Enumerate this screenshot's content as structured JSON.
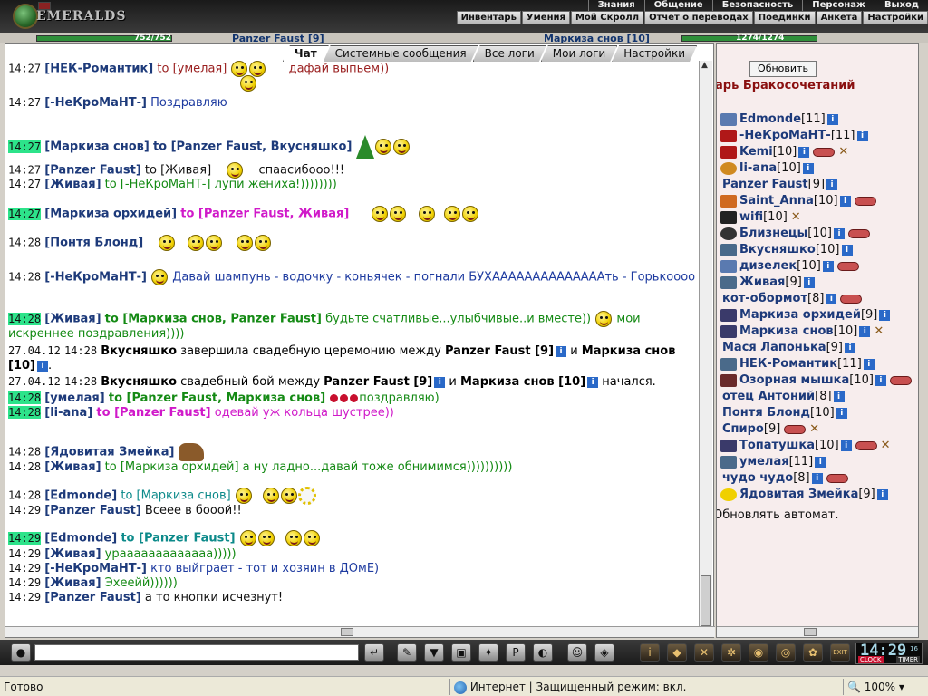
{
  "header": {
    "logo_text": "EMERALDS",
    "top_menu": [
      "Знания",
      "Общение",
      "Безопасность",
      "Персонаж",
      "Выход"
    ],
    "sub_menu": [
      "Инвентарь",
      "Умения",
      "Мой Скролл",
      "Отчет о переводах",
      "Поединки",
      "Анкета",
      "Настройки"
    ]
  },
  "char_strip": {
    "left_hp": "752/752",
    "left_name": "Panzer Faust [9]",
    "right_name": "Маркиза снов [10]",
    "right_hp": "1274/1274"
  },
  "tabs": [
    "Чат",
    "Системные сообщения",
    "Все логи",
    "Мои логи",
    "Настройки"
  ],
  "messages": [
    {
      "time": "14:27",
      "hl": false,
      "from": "[НЕК-Романтик]",
      "to": "to [умелая]",
      "toc": "to-red",
      "text": "дафай выпьем))",
      "tc": "c-red"
    },
    {
      "time": "14:27",
      "hl": false,
      "from": "[-НеКроМаНТ-]",
      "to": "",
      "toc": "",
      "text": "Поздравляю",
      "tc": "c-blue"
    },
    {
      "time": "14:27",
      "hl": true,
      "from": "[Маркиза снов]",
      "to": "to [Panzer Faust, Вкусняшко]",
      "toc": "to-navy",
      "text": "",
      "tc": ""
    },
    {
      "time": "14:27",
      "hl": false,
      "from": "[Panzer Faust]",
      "to": "to [Живая]",
      "toc": "c-black",
      "text": "спаaсибооо!!!",
      "tc": "c-black"
    },
    {
      "time": "14:27",
      "hl": false,
      "from": "[Живая]",
      "to": "to [-НеКроМаНТ-]",
      "toc": "c-green",
      "text": "лупи жениха!))))))))",
      "tc": "c-green"
    },
    {
      "time": "14:27",
      "hl": true,
      "from": "[Маркиза орхидей]",
      "to": "to [Panzer Faust, Живая]",
      "toc": "to-magenta",
      "text": "",
      "tc": ""
    },
    {
      "time": "14:28",
      "hl": false,
      "from": "[Понтя Блонд]",
      "to": "",
      "toc": "",
      "text": "",
      "tc": ""
    },
    {
      "time": "14:28",
      "hl": false,
      "from": "[-НеКроМаНТ-]",
      "to": "",
      "toc": "",
      "text": "Давай шампунь - водочку - коньячек - погнали БУХААААААААААААААть - Горькоооо",
      "tc": "c-blue"
    },
    {
      "time": "14:28",
      "hl": true,
      "from": "[Живая]",
      "to": "to [Маркиза снов, Panzer Faust]",
      "toc": "to-green",
      "text": "будьте счатливые...улыбчивые..и вместе))",
      "tc": "c-green",
      "text2": "мои искреннее поздравления))))"
    },
    {
      "time": "14:28",
      "hl": false,
      "date": "27.04.12",
      "system": "wedding_done"
    },
    {
      "time": "14:28",
      "hl": false,
      "date": "27.04.12",
      "system": "wedding_fight"
    },
    {
      "time": "14:28",
      "hl": true,
      "from": "[умелая]",
      "to": "to [Panzer Faust, Маркиза снов]",
      "toc": "to-green",
      "text": "поздравляю)",
      "tc": "c-green"
    },
    {
      "time": "14:28",
      "hl": true,
      "from": "[li-ana]",
      "to": "to [Panzer Faust]",
      "toc": "to-magenta",
      "text": "одевай уж кольца шустрее))",
      "tc": "c-magenta"
    },
    {
      "time": "14:28",
      "hl": false,
      "from": "[Ядовитая Змейка]",
      "to": "",
      "toc": "",
      "text": "",
      "tc": ""
    },
    {
      "time": "14:28",
      "hl": false,
      "from": "[Живая]",
      "to": "to [Маркиза орхидей]",
      "toc": "c-green",
      "text": "а ну ладно...давай тоже обнимимся))))))))))",
      "tc": "c-green"
    },
    {
      "time": "14:28",
      "hl": false,
      "from": "[Edmonde]",
      "to": "to [Маркиза снов]",
      "toc": "c-teal",
      "text": "",
      "tc": ""
    },
    {
      "time": "14:29",
      "hl": false,
      "from": "[Panzer Faust]",
      "to": "",
      "toc": "",
      "text": "Всеее в бооой!!",
      "tc": "c-black"
    },
    {
      "time": "14:29",
      "hl": true,
      "from": "[Edmonde]",
      "to": "to [Panzer Faust]",
      "toc": "to-teal",
      "text": "",
      "tc": ""
    },
    {
      "time": "14:29",
      "hl": false,
      "from": "[Живая]",
      "to": "",
      "toc": "",
      "text": "урааааааааааааа)))))",
      "tc": "c-green"
    },
    {
      "time": "14:29",
      "hl": false,
      "from": "[-НеКроМаНТ-]",
      "to": "",
      "toc": "",
      "text": "кто выйграет - тот и хозяин в ДОмЕ)",
      "tc": "c-blue"
    },
    {
      "time": "14:29",
      "hl": false,
      "from": "[Живая]",
      "to": "",
      "toc": "",
      "text": "Эхеейй))))))",
      "tc": "c-green"
    },
    {
      "time": "14:29",
      "hl": false,
      "from": "[Panzer Faust]",
      "to": "",
      "toc": "",
      "text": "а то кнопки исчезнут!",
      "tc": "c-black"
    }
  ],
  "system": {
    "done_actor": "Вкусняшко",
    "done_text": "завершила свадебную церемонию между",
    "groom": "Panzer Faust [9]",
    "and": "и",
    "bride": "Маркиза снов [10]",
    "fight_actor": "Вкусняшко",
    "fight_text": "свадебный бой между",
    "fight_end": "начался."
  },
  "right_panel": {
    "refresh_label": "Обновить",
    "room_title": "арь Бракосочетаний",
    "auto_refresh": "Обновлять автомат.",
    "users": [
      {
        "name": "Edmonde",
        "lvl": "[11]",
        "info": true,
        "mute": false,
        "cross": false,
        "icon": "shield"
      },
      {
        "name": "-НеКроМаНТ-",
        "lvl": "[11]",
        "info": true,
        "mute": false,
        "cross": false,
        "icon": "clan-red"
      },
      {
        "name": "Kemi",
        "lvl": "[10]",
        "info": true,
        "mute": true,
        "cross": true,
        "icon": "clan-red"
      },
      {
        "name": "li-ana",
        "lvl": "[10]",
        "info": true,
        "mute": false,
        "cross": false,
        "icon": "sun"
      },
      {
        "name": "Panzer Faust",
        "lvl": "[9]",
        "info": true,
        "mute": false,
        "cross": false,
        "icon": ""
      },
      {
        "name": "Saint_Anna",
        "lvl": "[10]",
        "info": true,
        "mute": true,
        "cross": false,
        "icon": "wings"
      },
      {
        "name": "wifi",
        "lvl": "[10]",
        "info": false,
        "mute": false,
        "cross": true,
        "icon": "dark"
      },
      {
        "name": "Близнецы",
        "lvl": "[10]",
        "info": true,
        "mute": true,
        "cross": false,
        "icon": "yin-yang"
      },
      {
        "name": "Вкусняшко",
        "lvl": "[10]",
        "info": true,
        "mute": false,
        "cross": false,
        "icon": "bird"
      },
      {
        "name": "дизелек",
        "lvl": "[10]",
        "info": true,
        "mute": true,
        "cross": false,
        "icon": "shield"
      },
      {
        "name": "Живая",
        "lvl": "[9]",
        "info": true,
        "mute": false,
        "cross": false,
        "icon": "bird"
      },
      {
        "name": "кот-обормот",
        "lvl": "[8]",
        "info": true,
        "mute": true,
        "cross": false,
        "icon": ""
      },
      {
        "name": "Маркиза орхидей",
        "lvl": "[9]",
        "info": true,
        "mute": false,
        "cross": false,
        "icon": "bat"
      },
      {
        "name": "Маркиза снов",
        "lvl": "[10]",
        "info": true,
        "mute": false,
        "cross": true,
        "icon": "bat"
      },
      {
        "name": "Мася Лапонька",
        "lvl": "[9]",
        "info": true,
        "mute": false,
        "cross": false,
        "icon": ""
      },
      {
        "name": "НЕК-Романтик",
        "lvl": "[11]",
        "info": true,
        "mute": false,
        "cross": false,
        "icon": "bird"
      },
      {
        "name": "Озорная мышка",
        "lvl": "[10]",
        "info": true,
        "mute": true,
        "cross": false,
        "icon": "paw"
      },
      {
        "name": "отец Антоний",
        "lvl": "[8]",
        "info": true,
        "mute": false,
        "cross": false,
        "icon": ""
      },
      {
        "name": "Понтя Блонд",
        "lvl": "[10]",
        "info": true,
        "mute": false,
        "cross": false,
        "icon": ""
      },
      {
        "name": "Спиро",
        "lvl": "[9]",
        "info": false,
        "mute": true,
        "cross": true,
        "icon": ""
      },
      {
        "name": "Топатушка",
        "lvl": "[10]",
        "info": true,
        "mute": true,
        "cross": true,
        "icon": "bat"
      },
      {
        "name": "умелая",
        "lvl": "[11]",
        "info": true,
        "mute": false,
        "cross": false,
        "icon": "bird"
      },
      {
        "name": "чудо чудо",
        "lvl": "[8]",
        "info": true,
        "mute": true,
        "cross": false,
        "icon": ""
      },
      {
        "name": "Ядовитая Змейка",
        "lvl": "[9]",
        "info": true,
        "mute": false,
        "cross": false,
        "icon": "smiley"
      }
    ]
  },
  "toolbar": {
    "input_value": "",
    "clock_time": "14:29",
    "clock_sec": "16",
    "clock_label": "CLOCK",
    "timer_label": "TIMER",
    "exit_label": "EXIT"
  },
  "statusbar": {
    "status": "Готово",
    "zone": "Интернет | Защищенный режим: вкл.",
    "zoom": "100%"
  }
}
